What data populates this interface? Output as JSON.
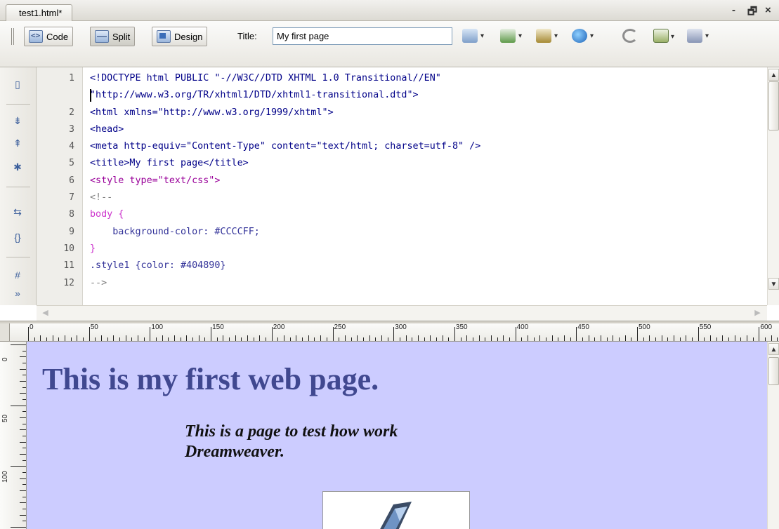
{
  "document_tab": {
    "label": "test1.html*"
  },
  "window_controls": {
    "minimize": "-",
    "restore": "🗗",
    "close": "×"
  },
  "toolbar": {
    "code_label": "Code",
    "split_label": "Split",
    "design_label": "Design",
    "title_label": "Title:",
    "title_value": "My first page",
    "icons": [
      "validate-markup-icon",
      "live-view-icon",
      "file-management-icon",
      "preview-in-browser-icon",
      "refresh-design-view-icon",
      "view-options-icon",
      "visual-aids-icon"
    ]
  },
  "code": {
    "lines": [
      {
        "num": "1",
        "text": "<!DOCTYPE html PUBLIC \"-//W3C//DTD XHTML 1.0 Transitional//EN\"",
        "kind": "tag"
      },
      {
        "num": "",
        "text": "\"http://www.w3.org/TR/xhtml1/DTD/xhtml1-transitional.dtd\">",
        "kind": "tag"
      },
      {
        "num": "2",
        "text": "<html xmlns=\"http://www.w3.org/1999/xhtml\">",
        "kind": "tag"
      },
      {
        "num": "3",
        "text": "<head>",
        "kind": "tag"
      },
      {
        "num": "4",
        "text": "<meta http-equiv=\"Content-Type\" content=\"text/html; charset=utf-8\" />",
        "kind": "tag"
      },
      {
        "num": "5",
        "text": "<title>My first page</title>",
        "kind": "tag"
      },
      {
        "num": "6",
        "text": "<style type=\"text/css\">",
        "kind": "style"
      },
      {
        "num": "7",
        "text": "<!--",
        "kind": "comment"
      },
      {
        "num": "8",
        "text": "body {",
        "kind": "css"
      },
      {
        "num": "9",
        "text": "    background-color: #CCCCFF;",
        "kind": "val"
      },
      {
        "num": "10",
        "text": "}",
        "kind": "css"
      },
      {
        "num": "11",
        "text": ".style1 {color: #404890}",
        "kind": "val"
      },
      {
        "num": "12",
        "text": "-->",
        "kind": "comment"
      }
    ]
  },
  "ruler": {
    "horizontal": [
      "0",
      "50",
      "100",
      "150",
      "200",
      "250",
      "300",
      "350",
      "400",
      "450",
      "500",
      "550",
      "600"
    ],
    "vertical": [
      "0",
      "50",
      "100"
    ]
  },
  "design": {
    "background": "#CCCCFF",
    "heading_color": "#404890",
    "heading": "This is my first web page.",
    "subtext": "This is a page to test how work Dreamweaver."
  }
}
